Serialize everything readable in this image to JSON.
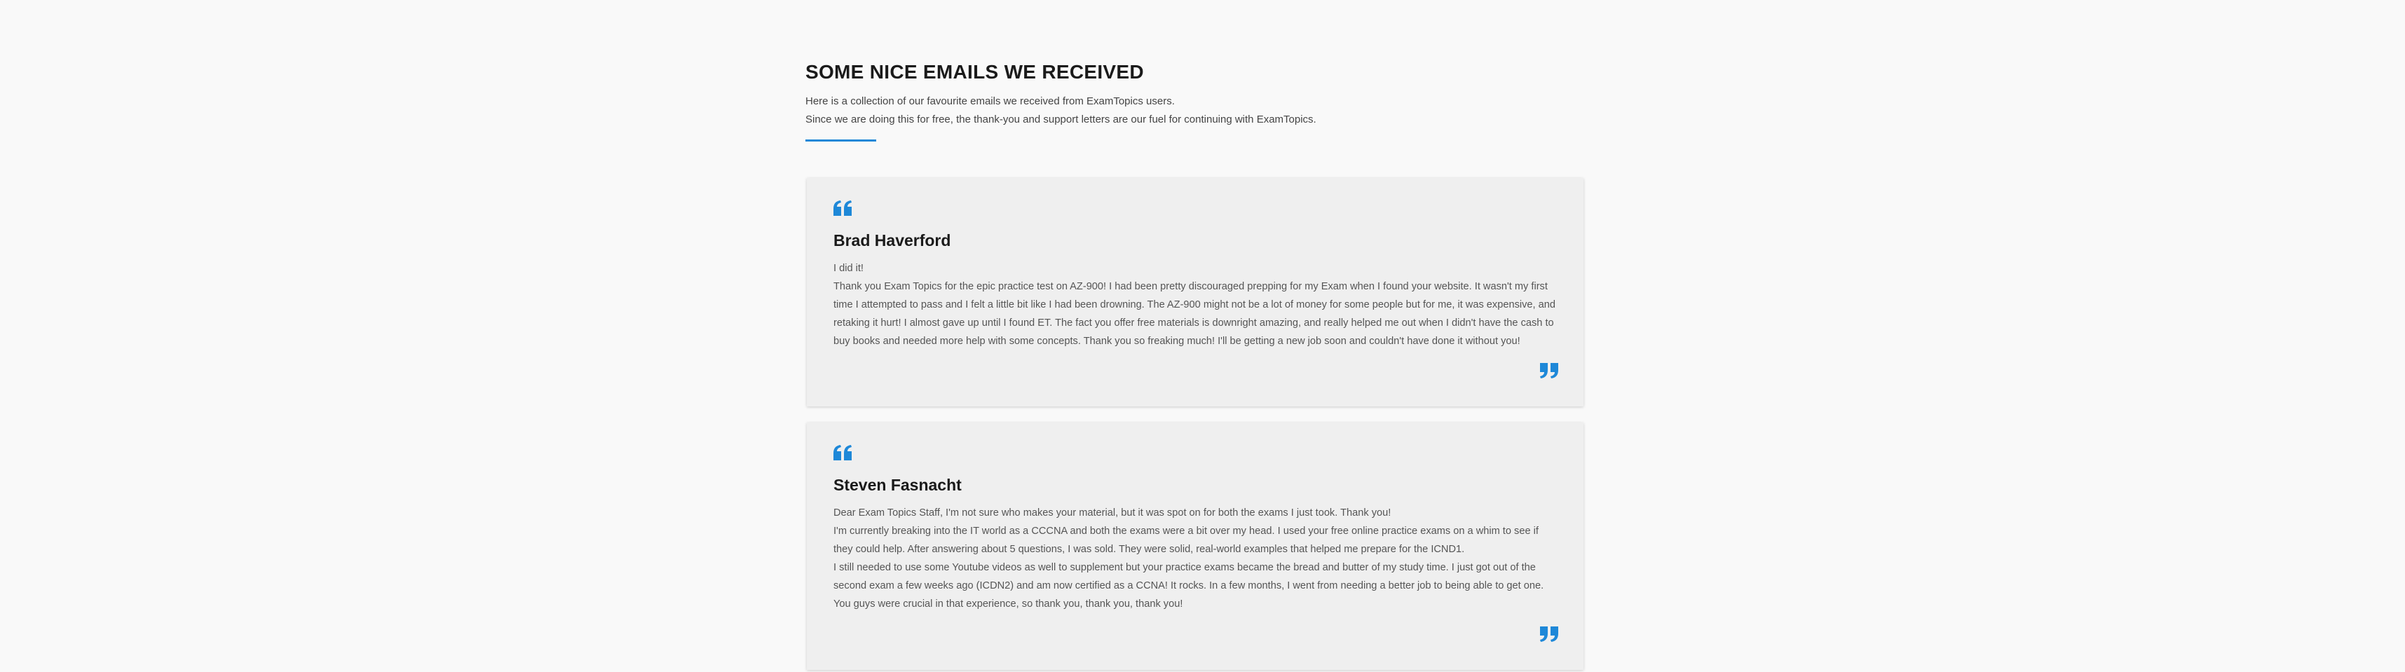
{
  "section": {
    "title": "SOME NICE EMAILS WE RECEIVED",
    "subtitle_lines": [
      "Here is a collection of our favourite emails we received from ExamTopics users.",
      "Since we are doing this for free, the thank-you and support letters are our fuel for continuing with ExamTopics."
    ]
  },
  "colors": {
    "accent": "#1e88d8",
    "card_background": "#efefef",
    "page_background": "#f9f9f9"
  },
  "testimonials": [
    {
      "author": "Brad Haverford",
      "paragraphs": [
        "I did it!",
        "Thank you Exam Topics for the epic practice test on AZ-900! I had been pretty discouraged prepping for my Exam when I found your website. It wasn't my first time I attempted to pass and I felt a little bit like I had been drowning. The AZ-900 might not be a lot of money for some people but for me, it was expensive, and retaking it hurt! I almost gave up until I found ET. The fact you offer free materials is downright amazing, and really helped me out when I didn't have the cash to buy books and needed more help with some concepts. Thank you so freaking much! I'll be getting a new job soon and couldn't have done it without you!"
      ]
    },
    {
      "author": "Steven Fasnacht",
      "paragraphs": [
        "Dear Exam Topics Staff, I'm not sure who makes your material, but it was spot on for both the exams I just took. Thank you!",
        "I'm currently breaking into the IT world as a CCCNA and both the exams were a bit over my head. I used your free online practice exams on a whim to see if they could help. After answering about 5 questions, I was sold. They were solid, real-world examples that helped me prepare for the ICND1.",
        "I still needed to use some Youtube videos as well to supplement but your practice exams became the bread and butter of my study time. I just got out of the second exam a few weeks ago (ICDN2) and am now certified as a CCNA! It rocks. In a few months, I went from needing a better job to being able to get one.",
        "You guys were crucial in that experience, so thank you, thank you, thank you!"
      ]
    }
  ]
}
